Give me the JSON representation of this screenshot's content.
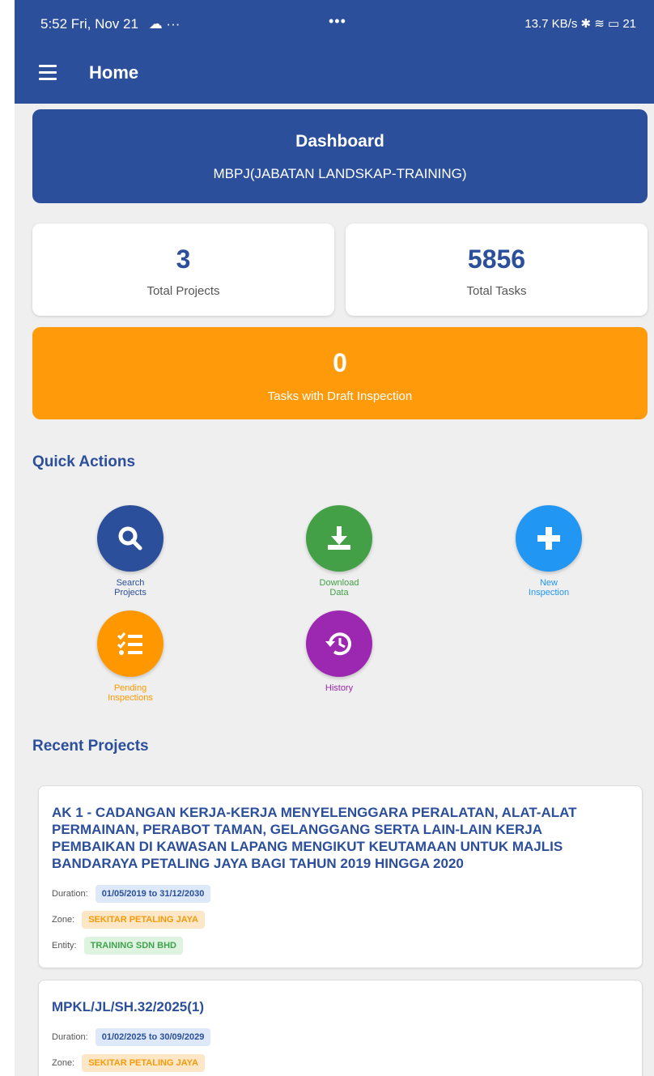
{
  "status_bar": {
    "time_date": "5:52 Fri, Nov 21",
    "left_icons": "☁ ···",
    "center_dots": "•••",
    "right_status": "13.7 KB/s ✱ ≋ ▭ 21"
  },
  "app_bar": {
    "title": "Home",
    "menu_icon": "hamburger-icon"
  },
  "dashboard": {
    "title": "Dashboard",
    "subtitle": "MBPJ(JABATAN LANDSKAP-TRAINING)"
  },
  "stats": {
    "total_projects_value": "3",
    "total_projects_label": "Total Projects",
    "total_tasks_value": "5856",
    "total_tasks_label": "Total Tasks",
    "draft_value": "0",
    "draft_label": "Tasks with Draft Inspection"
  },
  "quick_actions": {
    "heading": "Quick Actions",
    "items": [
      {
        "label": "Search Projects",
        "icon": "search-icon",
        "color": "#2c4f9b"
      },
      {
        "label": "Download Data",
        "icon": "download-icon",
        "color": "#43a047"
      },
      {
        "label": "New Inspection",
        "icon": "plus-icon",
        "color": "#2196f3"
      },
      {
        "label": "Pending Inspections",
        "icon": "checklist-icon",
        "color": "#ff9800"
      },
      {
        "label": "History",
        "icon": "history-icon",
        "color": "#9c27b0"
      }
    ]
  },
  "recent_projects": {
    "heading": "Recent Projects",
    "labels": {
      "duration": "Duration:",
      "zone": "Zone:",
      "entity": "Entity:"
    },
    "items": [
      {
        "title": "AK 1 - CADANGAN KERJA-KERJA MENYELENGGARA PERALATAN, ALAT-ALAT PERMAINAN, PERABOT TAMAN, GELANGGANG SERTA LAIN-LAIN KERJA PEMBAIKAN DI KAWASAN LAPANG MENGIKUT KEUTAMAAN UNTUK MAJLIS BANDARAYA PETALING JAYA BAGI TAHUN 2019 HINGGA 2020",
        "duration": "01/05/2019 to 31/12/2030",
        "zone": "SEKITAR PETALING JAYA",
        "entity": "TRAINING SDN BHD"
      },
      {
        "title": "MPKL/JL/SH.32/2025(1)",
        "duration": "01/02/2025 to 30/09/2029",
        "zone": "SEKITAR PETALING JAYA"
      }
    ]
  }
}
